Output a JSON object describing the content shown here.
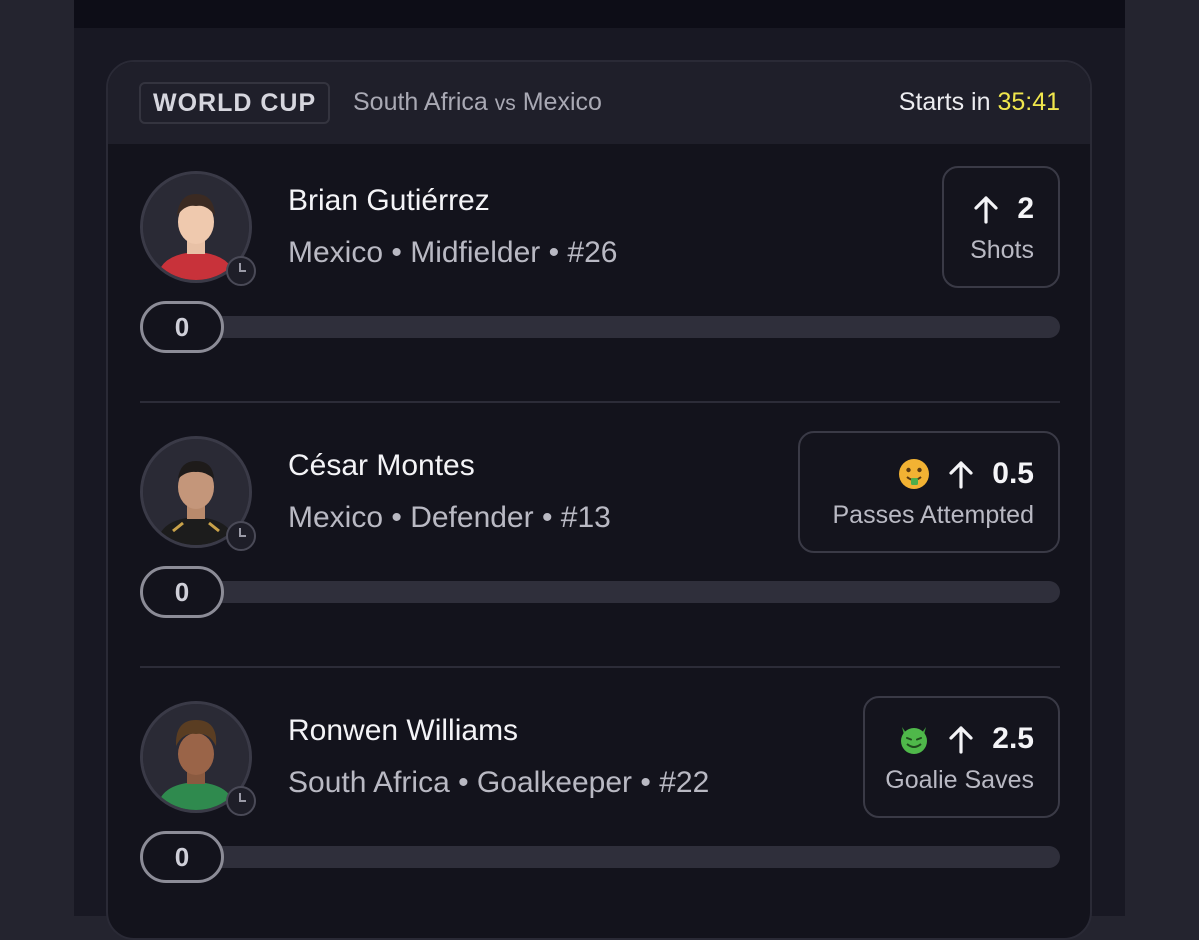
{
  "header": {
    "league": "WORLD CUP",
    "home_team": "South Africa",
    "vs": "vs",
    "away_team": "Mexico",
    "starts_label": "Starts in",
    "countdown": "35:41",
    "countdown_color": "#f0e64d"
  },
  "players": [
    {
      "name": "Brian Gutiérrez",
      "meta": "Mexico • Midfielder • #26",
      "stat_emoji": "",
      "stat_direction_icon": "arrow-up-icon",
      "stat_value": "2",
      "stat_label": "Shots",
      "count": "0",
      "progress": 0,
      "jersey_color": "#c8323a"
    },
    {
      "name": "César Montes",
      "meta": "Mexico • Defender • #13",
      "stat_emoji": "money-mouth-face-icon",
      "stat_direction_icon": "arrow-up-icon",
      "stat_value": "0.5",
      "stat_label": "Passes Attempted",
      "count": "0",
      "progress": 0,
      "jersey_color": "#1c1c1c"
    },
    {
      "name": "Ronwen Williams",
      "meta": "South Africa • Goalkeeper • #22",
      "stat_emoji": "smiling-devil-face-icon",
      "stat_direction_icon": "arrow-up-icon",
      "stat_value": "2.5",
      "stat_label": "Goalie Saves",
      "count": "0",
      "progress": 0,
      "jersey_color": "#2f8a4e"
    }
  ]
}
